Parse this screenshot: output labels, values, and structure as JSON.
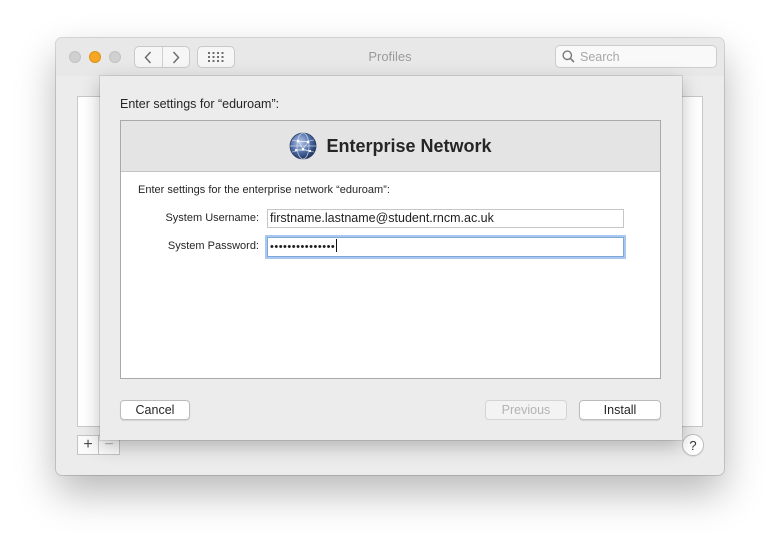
{
  "window": {
    "title": "Profiles",
    "search_placeholder": "Search",
    "plus_label": "+",
    "minus_label": "−",
    "help_label": "?"
  },
  "sheet": {
    "prompt": "Enter settings for “eduroam”:",
    "header_title": "Enterprise Network",
    "instruction": "Enter settings for the enterprise network “eduroam”:",
    "username_label": "System Username:",
    "username_value": "firstname.lastname@student.rncm.ac.uk",
    "password_label": "System Password:",
    "password_value": "•••••••••••••••",
    "buttons": {
      "cancel": "Cancel",
      "previous": "Previous",
      "install": "Install"
    }
  },
  "colors": {
    "accent_focus": "#a9c8f0",
    "minimize": "#f5a623"
  }
}
